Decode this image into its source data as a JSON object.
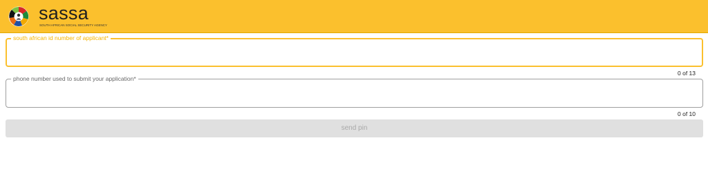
{
  "header": {
    "brand_name": "sassa",
    "brand_tagline": "SOUTH AFRICAN SOCIAL SECURITY AGENCY",
    "logo_icon": "sassa-logo-icon",
    "background_color": "#fbc02d"
  },
  "form": {
    "id_field": {
      "label": "south african id number of applicant*",
      "value": "",
      "counter": "0 of 13",
      "state": "focused",
      "accent_color": "#fbc02d"
    },
    "phone_field": {
      "label": "phone number used to submit your application*",
      "value": "",
      "counter": "0 of 10",
      "state": "default"
    },
    "submit_button": {
      "label": "send pin",
      "state": "disabled"
    }
  }
}
